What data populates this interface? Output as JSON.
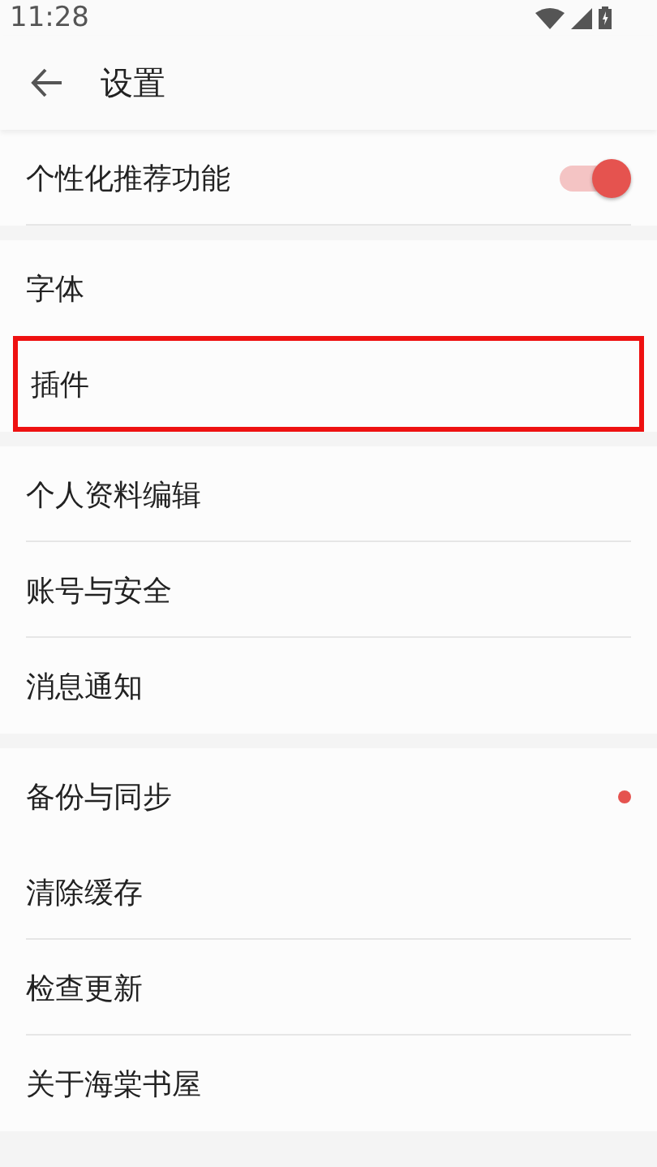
{
  "status_bar": {
    "time": "11:28"
  },
  "toolbar": {
    "title": "设置"
  },
  "groups": [
    {
      "items": [
        {
          "kind": "toggle",
          "label": "个性化推荐功能",
          "on": true,
          "divider": true,
          "highlighted": false,
          "dot": false
        }
      ]
    },
    {
      "items": [
        {
          "kind": "link",
          "label": "字体",
          "divider": false,
          "highlighted": false,
          "dot": false
        },
        {
          "kind": "link",
          "label": "插件",
          "divider": false,
          "highlighted": true,
          "dot": false
        }
      ]
    },
    {
      "items": [
        {
          "kind": "link",
          "label": "个人资料编辑",
          "divider": true,
          "highlighted": false,
          "dot": false
        },
        {
          "kind": "link",
          "label": "账号与安全",
          "divider": true,
          "highlighted": false,
          "dot": false
        },
        {
          "kind": "link",
          "label": "消息通知",
          "divider": false,
          "highlighted": false,
          "dot": false
        }
      ]
    },
    {
      "items": [
        {
          "kind": "link",
          "label": "备份与同步",
          "divider": false,
          "highlighted": false,
          "dot": true
        },
        {
          "kind": "link",
          "label": "清除缓存",
          "divider": true,
          "highlighted": false,
          "dot": false
        },
        {
          "kind": "link",
          "label": "检查更新",
          "divider": true,
          "highlighted": false,
          "dot": false
        },
        {
          "kind": "link",
          "label": "关于海棠书屋",
          "divider": false,
          "highlighted": false,
          "dot": false
        }
      ]
    }
  ]
}
